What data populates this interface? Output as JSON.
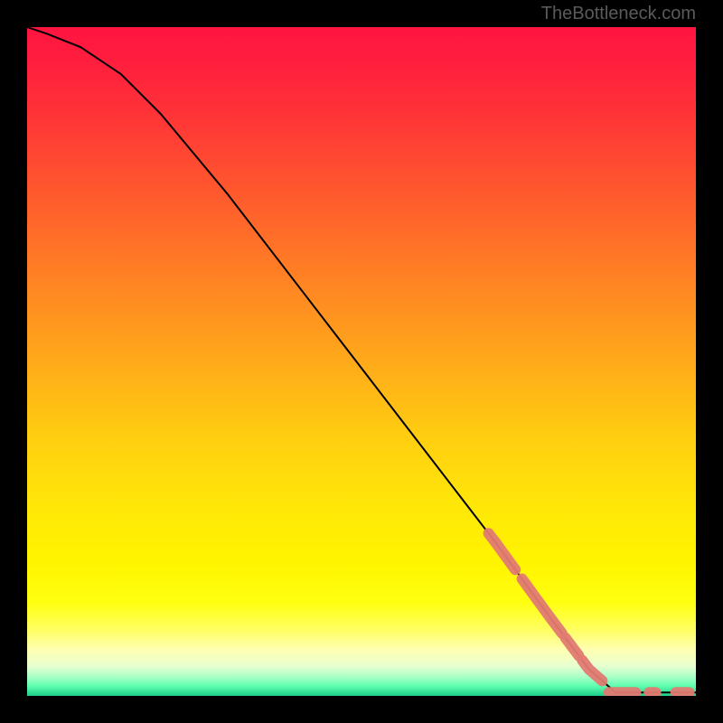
{
  "watermark": "TheBottleneck.com",
  "chart_data": {
    "type": "line",
    "title": "",
    "xlabel": "",
    "ylabel": "",
    "xlim": [
      0,
      100
    ],
    "ylim": [
      0,
      100
    ],
    "grid": false,
    "series": [
      {
        "name": "curve",
        "color": "#000000",
        "points": [
          {
            "x": 0,
            "y": 100
          },
          {
            "x": 3,
            "y": 99
          },
          {
            "x": 8,
            "y": 97
          },
          {
            "x": 14,
            "y": 93
          },
          {
            "x": 20,
            "y": 87
          },
          {
            "x": 30,
            "y": 75
          },
          {
            "x": 40,
            "y": 62
          },
          {
            "x": 50,
            "y": 49
          },
          {
            "x": 60,
            "y": 36
          },
          {
            "x": 70,
            "y": 23
          },
          {
            "x": 78,
            "y": 12
          },
          {
            "x": 84,
            "y": 4
          },
          {
            "x": 88,
            "y": 0.5
          },
          {
            "x": 100,
            "y": 0.5
          }
        ]
      }
    ],
    "markers": {
      "style": "dashed-segments",
      "color": "#e27a72",
      "radius": 6,
      "segments": [
        {
          "x_start": 69,
          "x_end": 73,
          "slope": "diagonal"
        },
        {
          "x_start": 74,
          "x_end": 80,
          "slope": "diagonal"
        },
        {
          "x_start": 80.5,
          "x_end": 82.5,
          "slope": "diagonal"
        },
        {
          "x_start": 83,
          "x_end": 86,
          "slope": "diagonal"
        },
        {
          "x_start": 87,
          "x_end": 91,
          "slope": "flat"
        },
        {
          "x_start": 93,
          "x_end": 94,
          "slope": "flat"
        },
        {
          "x_start": 97,
          "x_end": 99,
          "slope": "flat"
        }
      ]
    },
    "background": {
      "type": "vertical-gradient",
      "stops": [
        {
          "pos": 0,
          "color": "#ff1440"
        },
        {
          "pos": 0.5,
          "color": "#ffb018"
        },
        {
          "pos": 0.85,
          "color": "#ffff20"
        },
        {
          "pos": 1.0,
          "color": "#1cce88"
        }
      ]
    }
  }
}
